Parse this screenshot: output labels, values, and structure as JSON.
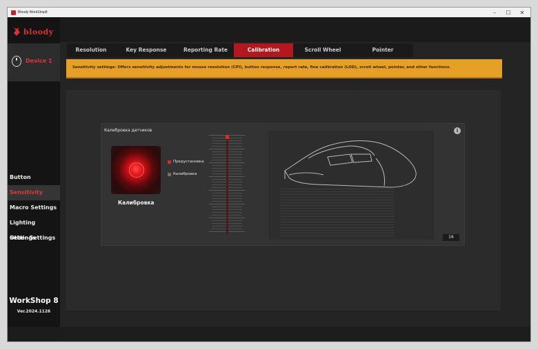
{
  "window": {
    "title": "Bloody WorkShop8",
    "controls": [
      "–",
      "☐",
      "✕"
    ]
  },
  "logo": {
    "text": "bloody"
  },
  "device": {
    "label": "Device 1"
  },
  "nav": {
    "items": [
      {
        "label": "Button"
      },
      {
        "label": "Sensitivity"
      },
      {
        "label": "Macro Settings"
      },
      {
        "label": "Lighting Settings"
      },
      {
        "label": "Other Settings"
      }
    ],
    "active_index": 1
  },
  "footer": {
    "title": "WorkShop 8",
    "version": "Ver.2024.1126"
  },
  "tabs": [
    {
      "label": "Resolution"
    },
    {
      "label": "Key Response"
    },
    {
      "label": "Reporting Rate"
    },
    {
      "label": "Calibration"
    },
    {
      "label": "Scroll Wheel"
    },
    {
      "label": "Pointer"
    }
  ],
  "active_tab_index": 3,
  "banner": {
    "text": "Sensitivity settings: Offers sensitivity adjustments for mouse resolution (CPI), button response, report rate, fine calibration (LOD), scroll wheel, pointer, and other functions."
  },
  "calibration": {
    "panel_title": "Калибровка датчиков",
    "sensor_label": "Калибровка",
    "options": [
      {
        "label": "Предустановка",
        "selected": true
      },
      {
        "label": "Калибровка",
        "selected": false
      }
    ],
    "slider_level": 0,
    "value": "16"
  },
  "colors": {
    "accent": "#b4181e",
    "banner": "#e6a026",
    "active_text": "#e0373c"
  }
}
